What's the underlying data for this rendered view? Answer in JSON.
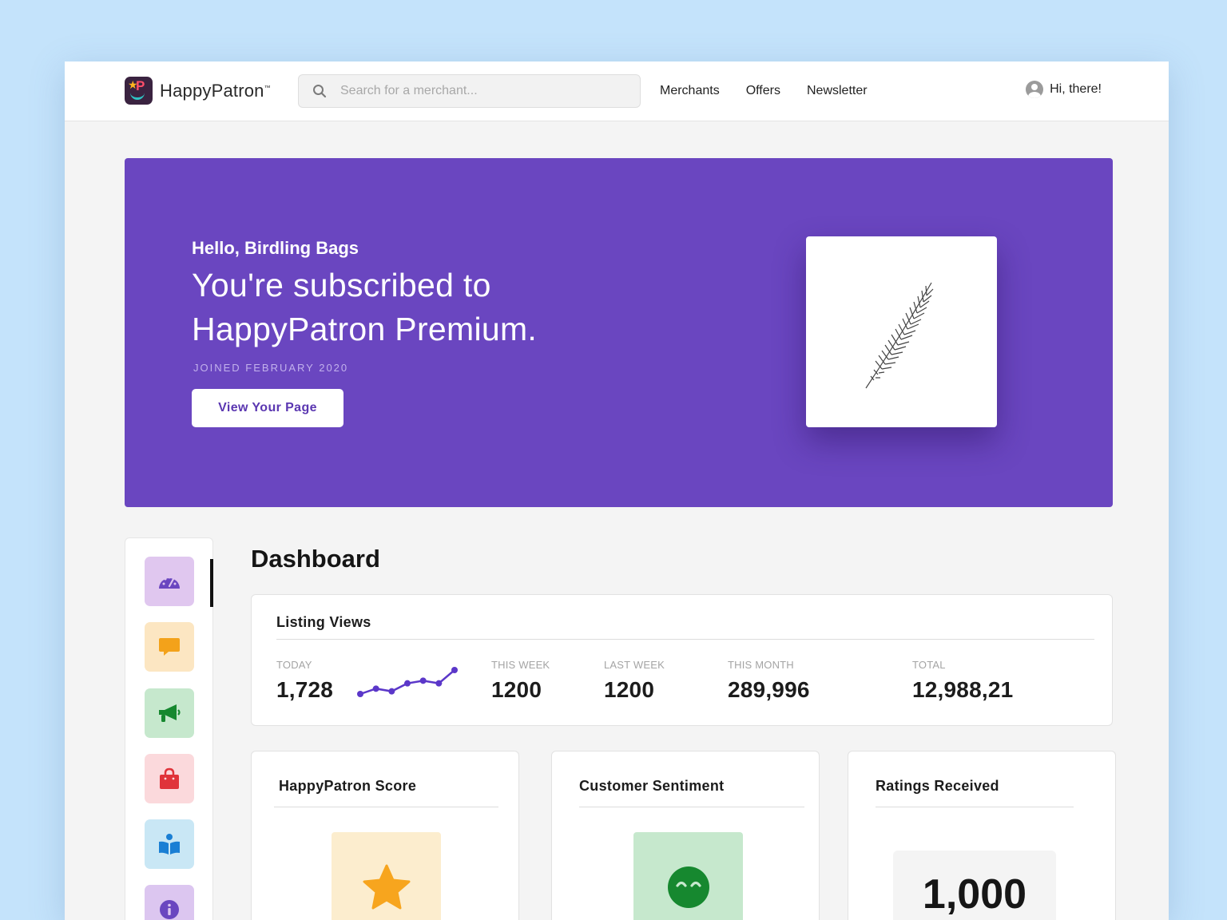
{
  "header": {
    "logo_text": "HappyPatron",
    "logo_tm": "™",
    "search_placeholder": "Search for a merchant...",
    "nav": [
      "Merchants",
      "Offers",
      "Newsletter"
    ],
    "user_label": "Hi, there!"
  },
  "hero": {
    "greeting": "Hello, Birdling Bags",
    "title": "You're subscribed to HappyPatron Premium.",
    "joined": "JOINED FEBRUARY 2020",
    "button_label": "View Your Page",
    "background_color": "#6a46c0"
  },
  "sidebar": {
    "items": [
      {
        "icon": "speedometer-icon",
        "color": "#e0c7ef",
        "active": true
      },
      {
        "icon": "chat-icon",
        "color": "#fce6c2",
        "active": false
      },
      {
        "icon": "megaphone-icon",
        "color": "#c6e8cd",
        "active": false
      },
      {
        "icon": "shopping-bag-icon",
        "color": "#fbd9dc",
        "active": false
      },
      {
        "icon": "book-reader-icon",
        "color": "#c9e7f5",
        "active": false
      },
      {
        "icon": "info-icon",
        "color": "#dcc6f0",
        "active": false
      }
    ]
  },
  "dashboard": {
    "title": "Dashboard",
    "listing_views": {
      "title": "Listing Views",
      "stats": [
        {
          "label": "TODAY",
          "value": "1,728"
        },
        {
          "label": "THIS WEEK",
          "value": "1200"
        },
        {
          "label": "LAST WEEK",
          "value": "1200"
        },
        {
          "label": "THIS MONTH",
          "value": "289,996"
        },
        {
          "label": "TOTAL",
          "value": "12,988,21"
        }
      ],
      "sparkline": [
        2,
        4,
        3,
        6,
        7,
        6,
        11
      ]
    },
    "cards": [
      {
        "title": "HappyPatron Score",
        "icon": "star-icon",
        "tile_color": "#fcedce"
      },
      {
        "title": "Customer Sentiment",
        "icon": "happy-face-icon",
        "tile_color": "#c6e8cd"
      },
      {
        "title": "Ratings Received",
        "value": "1,000"
      }
    ]
  }
}
